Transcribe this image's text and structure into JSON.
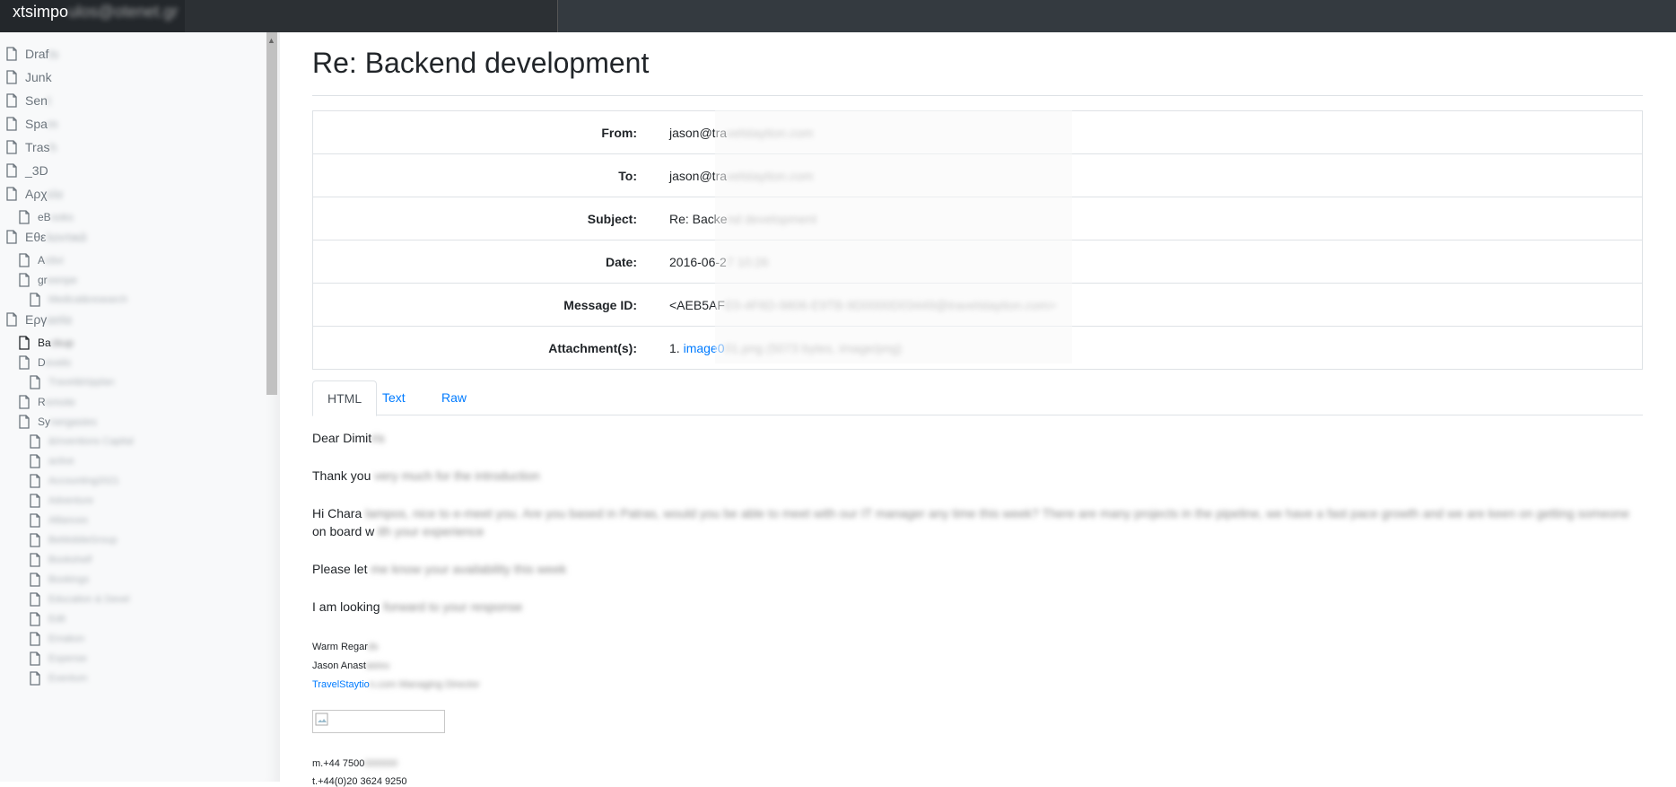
{
  "topbar": {
    "user": "xtsimpo",
    "user_blurred": "ulos@otenet.gr"
  },
  "sidebar": {
    "folders": [
      {
        "label": "Draf",
        "blur": "ts",
        "level": 0,
        "active": false
      },
      {
        "label": "Junk",
        "blur": "",
        "level": 0,
        "active": false
      },
      {
        "label": "Sen",
        "blur": "t",
        "level": 0,
        "active": false
      },
      {
        "label": "Spa",
        "blur": "m",
        "level": 0,
        "active": false
      },
      {
        "label": "Tras",
        "blur": "h",
        "level": 0,
        "active": false
      },
      {
        "label": "_3D",
        "blur": "",
        "level": 0,
        "active": false
      },
      {
        "label": "Αρχ",
        "blur": "εία",
        "level": 0,
        "active": false
      },
      {
        "label": "eB",
        "blur": "ooks",
        "level": 1,
        "active": false
      },
      {
        "label": "Εθε",
        "blur": "λοντικά",
        "level": 0,
        "active": false
      },
      {
        "label": "A",
        "blur": "ctivi",
        "level": 1,
        "active": false
      },
      {
        "label": "gr",
        "blur": "eenpe",
        "level": 1,
        "active": false
      },
      {
        "label": "",
        "blur": "Medical&research",
        "level": 2,
        "active": false
      },
      {
        "label": "Εργ",
        "blur": "ασία",
        "level": 0,
        "active": false
      },
      {
        "label": "Ba",
        "blur": "ckup",
        "level": 1,
        "active": true
      },
      {
        "label": "D",
        "blur": "evelo",
        "level": 1,
        "active": false
      },
      {
        "label": "",
        "blur": "Travel&tripplan",
        "level": 2,
        "active": false
      },
      {
        "label": "R",
        "blur": "emote",
        "level": 1,
        "active": false
      },
      {
        "label": "Sy",
        "blur": "nergasies",
        "level": 1,
        "active": false
      },
      {
        "label": "",
        "blur": "&Inventions Capital",
        "level": 2,
        "active": false
      },
      {
        "label": "",
        "blur": "active",
        "level": 2,
        "active": false
      },
      {
        "label": "",
        "blur": "Accounting2021",
        "level": 2,
        "active": false
      },
      {
        "label": "",
        "blur": "Adventure",
        "level": 2,
        "active": false
      },
      {
        "label": "",
        "blur": "Alliances",
        "level": 2,
        "active": false
      },
      {
        "label": "",
        "blur": "BeMobileGroup",
        "level": 2,
        "active": false
      },
      {
        "label": "",
        "blur": "Bookshelf",
        "level": 2,
        "active": false
      },
      {
        "label": "",
        "blur": "Bookings",
        "level": 2,
        "active": false
      },
      {
        "label": "",
        "blur": "Education & Devel",
        "level": 2,
        "active": false
      },
      {
        "label": "",
        "blur": "Edit",
        "level": 2,
        "active": false
      },
      {
        "label": "",
        "blur": "Emakon",
        "level": 2,
        "active": false
      },
      {
        "label": "",
        "blur": "Expense",
        "level": 2,
        "active": false
      },
      {
        "label": "",
        "blur": "Eventum",
        "level": 2,
        "active": false
      }
    ]
  },
  "email": {
    "title": "Re: Backend development",
    "meta": [
      {
        "key": "From:",
        "value": "jason@tra",
        "blur": "velstaytion.com"
      },
      {
        "key": "To:",
        "value": "jason@tra",
        "blur": "velstaytion.com"
      },
      {
        "key": "Subject:",
        "value": "Re: Backe",
        "blur": "nd development"
      },
      {
        "key": "Date:",
        "value": "2016-06-2",
        "blur": "7 10:26"
      },
      {
        "key": "Message ID:",
        "value": "<AEB5AF",
        "blur": "E0-4F6D-9806-E9TB-9D0000D03449@travelstaytion.com>"
      }
    ],
    "attachment": {
      "key": "Attachment(s):",
      "prefix": "1.",
      "link": "image0",
      "link_blur": "01.png",
      "tail_blur": "(5073 bytes, image/png)"
    },
    "tabs": [
      {
        "label": "HTML",
        "active": true
      },
      {
        "label": "Text",
        "active": false
      },
      {
        "label": "Raw",
        "active": false
      }
    ],
    "body": {
      "greeting": "Dear Dimit",
      "greeting_blur": "ris",
      "p1": "Thank you",
      "p1_blur": "very much for the introduction",
      "p2": "Hi Chara",
      "p2_blur": "lampos, nice to e-meet you. Are you based in Patras, would you be able to meet with our IT manager any time this week? There are many projects in the pipeline, we have a fast pace growth and we are keen on getting someone",
      "p2b": "on board w",
      "p2b_blur": "ith your experience",
      "p3": "Please let",
      "p3_blur": "me know your availability this week",
      "p4": "I am looking",
      "p4_blur": "forward to your response",
      "sig1": "Warm Regar",
      "sig1_blur": "ds",
      "sig2": "Jason Anast",
      "sig2_blur": "asiou",
      "sig3": "TravelStaytio",
      "sig3_blur": "n.com",
      "sig3_tail_blur": "Managing Director",
      "phone1": "m.+44 7500",
      "phone1_blur": "000000",
      "phone2": "t.+44(0)20 3624 9250"
    }
  }
}
